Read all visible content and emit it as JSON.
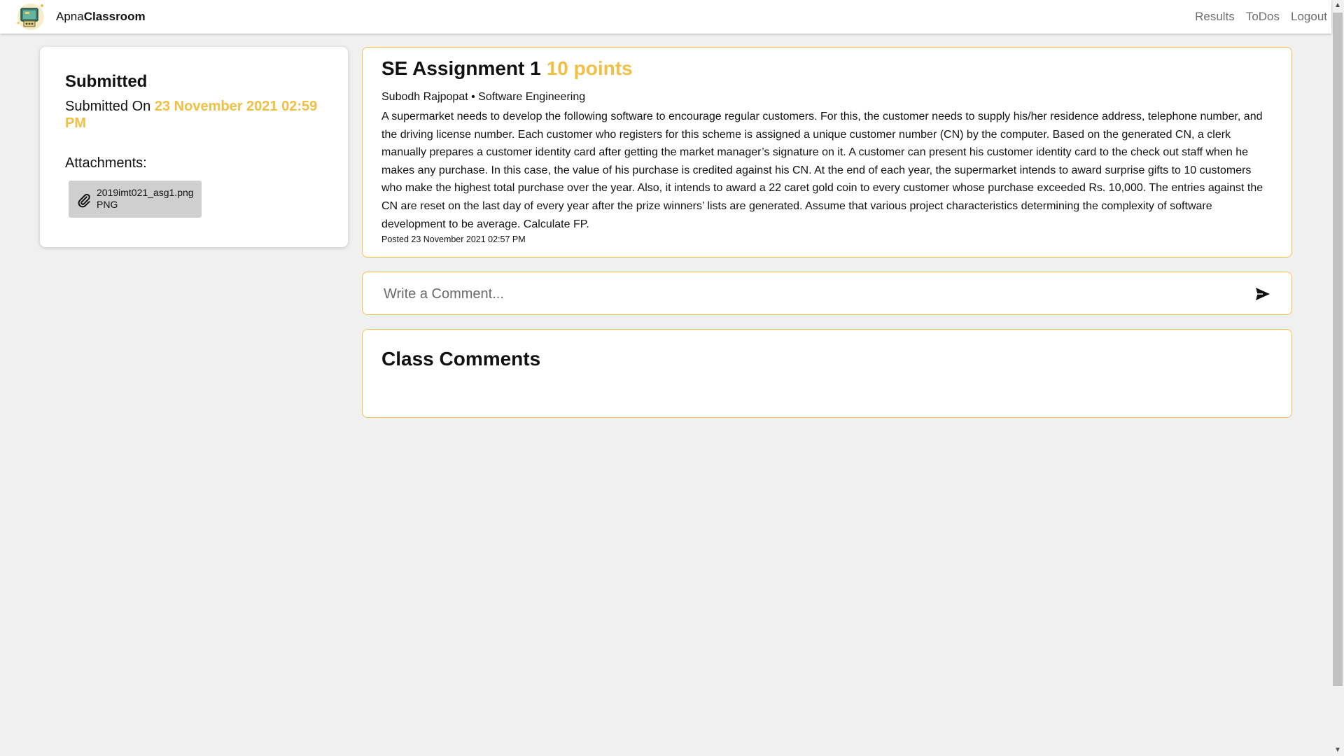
{
  "navbar": {
    "brand_prefix": "Apna",
    "brand_bold": "Classroom",
    "links": [
      "Results",
      "ToDos",
      "Logout"
    ]
  },
  "submission": {
    "status": "Submitted",
    "submitted_on_label": "Submitted On",
    "submitted_on_value": "23 November 2021 02:59 PM",
    "attachments_label": "Attachments:",
    "attachment": {
      "filename": "2019imt021_asg1.png",
      "type": "PNG"
    }
  },
  "assignment": {
    "title": "SE Assignment 1",
    "points": "10 points",
    "meta": "Subodh Rajpopat • Software Engineering",
    "description": "A supermarket needs to develop the following software to encourage regular customers. For this, the customer needs to supply his/her residence address, telephone number, and the driving license number. Each customer who registers for this scheme is assigned a unique customer number (CN) by the computer. Based on the generated CN, a clerk manually prepares a customer identity card after getting the market manager’s signature on it. A customer can present his customer identity card to the check out staff when he makes any purchase. In this case, the value of his purchase is credited against his CN. At the end of each year, the supermarket intends to award surprise gifts to 10 customers who make the highest total purchase over the year. Also, it intends to award a 22 caret gold coin to every customer whose purchase exceeded Rs. 10,000. The entries against the CN are reset on the last day of every year after the prize winners’ lists are generated. Assume that various project characteristics determining the complexity of software development to be average. Calculate FP.",
    "posted": "Posted 23 November 2021 02:57 PM"
  },
  "comment": {
    "placeholder": "Write a Comment..."
  },
  "class_comments": {
    "title": "Class Comments"
  },
  "colors": {
    "accent": "#f2bf42",
    "card_border": "#f2c34b",
    "background": "#f0f0f0"
  }
}
